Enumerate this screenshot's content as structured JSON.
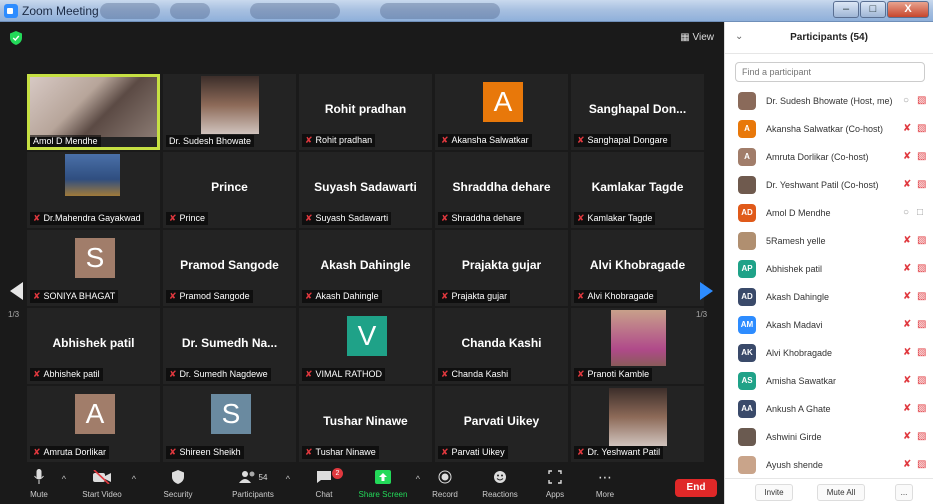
{
  "window": {
    "title": "Zoom Meeting",
    "buttons": {
      "minimize": "–",
      "maximize": "□",
      "close": "X"
    }
  },
  "meeting": {
    "view_label": "View",
    "tiles": [
      {
        "big": "",
        "label": "Amol  D Mendhe",
        "avatar": "",
        "photo": true,
        "active": true
      },
      {
        "big": "",
        "label": "Dr. Sudesh Bhowate",
        "avatar": "",
        "photo": true
      },
      {
        "big": "Rohit  pradhan",
        "label": "Rohit  pradhan"
      },
      {
        "big": "",
        "label": "Akansha Salwatkar",
        "avatar": "A",
        "avatar_color": "#e8780a"
      },
      {
        "big": "Sanghapal Don...",
        "label": "Sanghapal Dongare"
      },
      {
        "big": "",
        "label": "Dr.Mahendra Gayakwad",
        "photo": true
      },
      {
        "big": "Prince",
        "label": "Prince"
      },
      {
        "big": "Suyash Sadawarti",
        "label": "Suyash Sadawarti"
      },
      {
        "big": "Shraddha dehare",
        "label": "Shraddha dehare"
      },
      {
        "big": "Kamlakar Tagde",
        "label": "Kamlakar Tagde"
      },
      {
        "big": "",
        "label": "SONIYA BHAGAT",
        "avatar": "S",
        "avatar_color": "#a17d6a"
      },
      {
        "big": "Pramod Sangode",
        "label": "Pramod Sangode"
      },
      {
        "big": "Akash Dahingle",
        "label": "Akash Dahingle"
      },
      {
        "big": "Prajakta gujar",
        "label": "Prajakta gujar"
      },
      {
        "big": "Alvi Khobragade",
        "label": "Alvi Khobragade"
      },
      {
        "big": "Abhishek patil",
        "label": "Abhishek patil"
      },
      {
        "big": "Dr. Sumedh Na...",
        "label": "Dr. Sumedh Nagdewe"
      },
      {
        "big": "",
        "label": "VIMAL RATHOD",
        "avatar": "V",
        "avatar_color": "#1fa288"
      },
      {
        "big": "Chanda Kashi",
        "label": "Chanda Kashi"
      },
      {
        "big": "",
        "label": "Pranoti Kamble",
        "photo": true
      },
      {
        "big": "",
        "label": "Amruta Dorlikar",
        "avatar": "A",
        "avatar_color": "#a17d6a"
      },
      {
        "big": "",
        "label": "Shireen Sheikh",
        "avatar": "S",
        "avatar_color": "#6a8aa0"
      },
      {
        "big": "Tushar Ninawe",
        "label": "Tushar Ninawe"
      },
      {
        "big": "Parvati Uikey",
        "label": "Parvati Uikey"
      },
      {
        "big": "",
        "label": "Dr. Yeshwant Patil",
        "photo": true
      }
    ],
    "page_left": "1/3",
    "page_right": "1/3"
  },
  "toolbar": {
    "mute": "Mute",
    "start_video": "Start Video",
    "security": "Security",
    "participants": "Participants",
    "participants_count": "54",
    "chat": "Chat",
    "chat_badge": "2",
    "share_screen": "Share Screen",
    "record": "Record",
    "reactions": "Reactions",
    "apps": "Apps",
    "more": "More",
    "end": "End"
  },
  "panel": {
    "title": "Participants (54)",
    "search_placeholder": "Find a participant",
    "participants": [
      {
        "initials": "",
        "color": "#8a6a5a",
        "name": "Dr. Sudesh Bhowate (Host, me)",
        "mic": "grey",
        "cam": "red"
      },
      {
        "initials": "A",
        "color": "#e8780a",
        "name": "Akansha Salwatkar (Co-host)",
        "mic": "red",
        "cam": "red"
      },
      {
        "initials": "A",
        "color": "#a17d6a",
        "name": "Amruta Dorlikar (Co-host)",
        "mic": "red",
        "cam": "red"
      },
      {
        "initials": "",
        "color": "#6f5a4e",
        "name": "Dr. Yeshwant Patil (Co-host)",
        "mic": "red",
        "cam": "red"
      },
      {
        "initials": "AD",
        "color": "#e05a1a",
        "name": "Amol  D Mendhe",
        "mic": "grey",
        "cam": "grey"
      },
      {
        "initials": "",
        "color": "#b08f70",
        "name": "5Ramesh yelle",
        "mic": "red",
        "cam": "red"
      },
      {
        "initials": "AP",
        "color": "#1fa288",
        "name": "Abhishek patil",
        "mic": "red",
        "cam": "red"
      },
      {
        "initials": "AD",
        "color": "#3a4a6a",
        "name": "Akash Dahingle",
        "mic": "red",
        "cam": "red"
      },
      {
        "initials": "AM",
        "color": "#2d8cff",
        "name": "Akash Madavi",
        "mic": "red",
        "cam": "red"
      },
      {
        "initials": "AK",
        "color": "#3a4a6a",
        "name": "Alvi Khobragade",
        "mic": "red",
        "cam": "red"
      },
      {
        "initials": "AS",
        "color": "#1fa288",
        "name": "Amisha Sawatkar",
        "mic": "red",
        "cam": "red"
      },
      {
        "initials": "AA",
        "color": "#3a4a6a",
        "name": "Ankush A Ghate",
        "mic": "red",
        "cam": "red"
      },
      {
        "initials": "",
        "color": "#6a5a50",
        "name": "Ashwini Girde",
        "mic": "red",
        "cam": "red"
      },
      {
        "initials": "",
        "color": "#c9a48a",
        "name": "Ayush shende",
        "mic": "red",
        "cam": "red"
      }
    ],
    "invite": "Invite",
    "mute_all": "Mute All",
    "more": "..."
  }
}
